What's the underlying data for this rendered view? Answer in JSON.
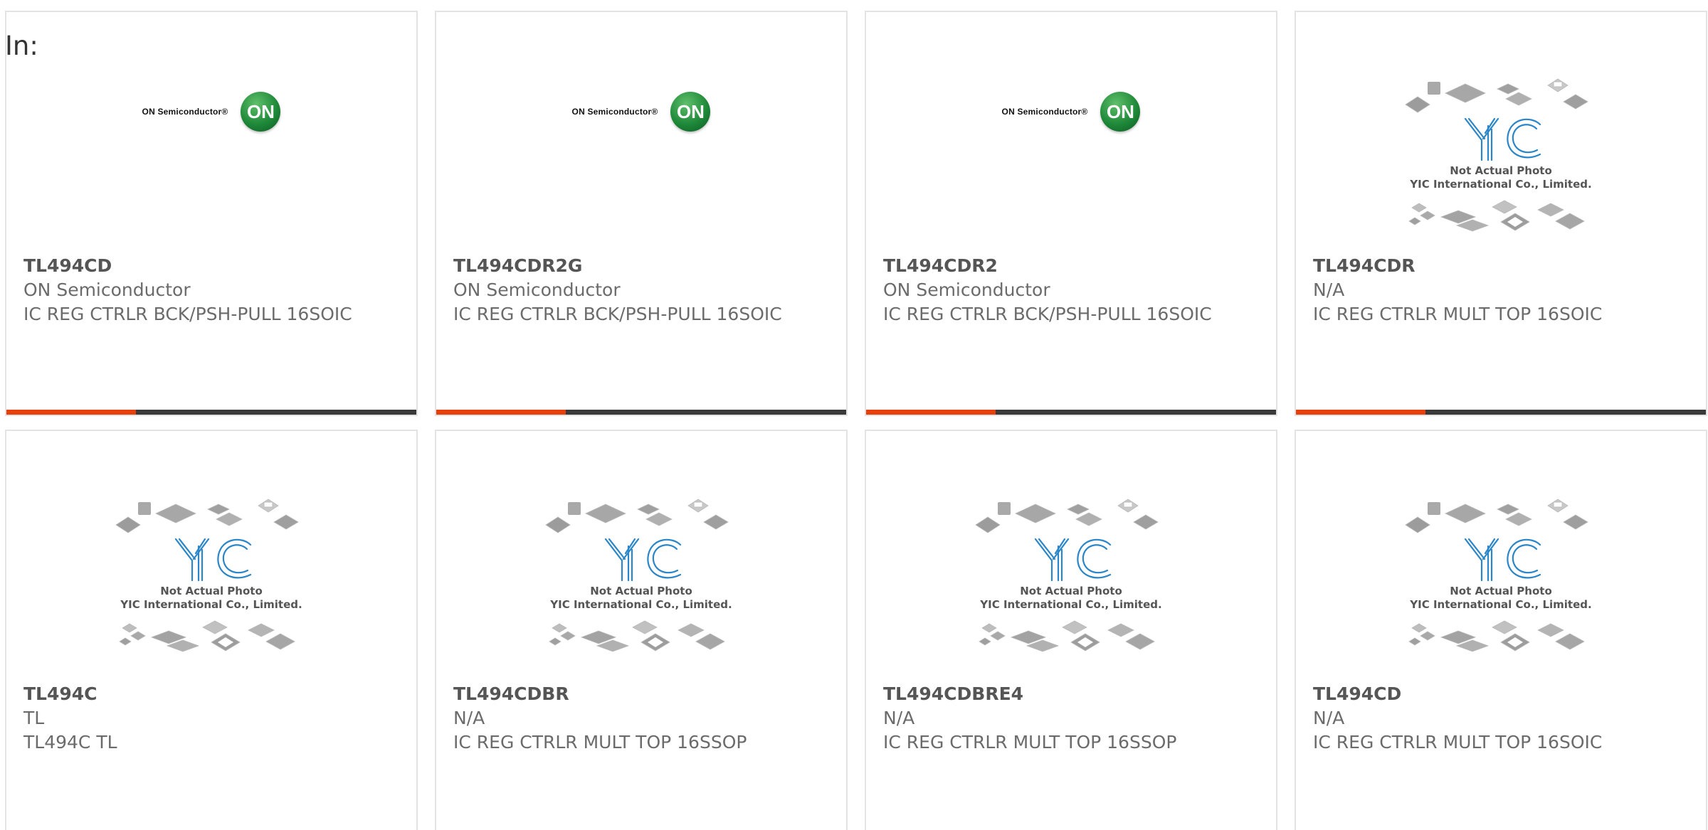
{
  "header": {
    "in_label": "In:"
  },
  "colors": {
    "accent": "#e8400c",
    "bar": "#3a3a3a",
    "border": "#e3e3e3",
    "text": "#6b6b6b"
  },
  "cards": [
    {
      "part": "TL494CD",
      "manufacturer": "ON Semiconductor",
      "description": "IC REG CTRLR BCK/PSH-PULL 16SOIC",
      "image": "on-semiconductor-logo",
      "logo_wordmark": "ON Semiconductor®",
      "logo_mark": "ON"
    },
    {
      "part": "TL494CDR2G",
      "manufacturer": "ON Semiconductor",
      "description": "IC REG CTRLR BCK/PSH-PULL 16SOIC",
      "image": "on-semiconductor-logo",
      "logo_wordmark": "ON Semiconductor®",
      "logo_mark": "ON"
    },
    {
      "part": "TL494CDR2",
      "manufacturer": "ON Semiconductor",
      "description": "IC REG CTRLR BCK/PSH-PULL 16SOIC",
      "image": "on-semiconductor-logo",
      "logo_wordmark": "ON Semiconductor®",
      "logo_mark": "ON"
    },
    {
      "part": "TL494CDR",
      "manufacturer": "N/A",
      "description": "IC REG CTRLR MULT TOP 16SOIC",
      "image": "yic-placeholder",
      "ph_line1": "Not Actual Photo",
      "ph_line2": "YIC International Co., Limited."
    },
    {
      "part": "TL494C",
      "manufacturer": "TL",
      "description": "TL494C TL",
      "image": "yic-placeholder",
      "ph_line1": "Not Actual Photo",
      "ph_line2": "YIC International Co., Limited."
    },
    {
      "part": "TL494CDBR",
      "manufacturer": "N/A",
      "description": "IC REG CTRLR MULT TOP 16SSOP",
      "image": "yic-placeholder",
      "ph_line1": "Not Actual Photo",
      "ph_line2": "YIC International Co., Limited."
    },
    {
      "part": "TL494CDBRE4",
      "manufacturer": "N/A",
      "description": "IC REG CTRLR MULT TOP 16SSOP",
      "image": "yic-placeholder",
      "ph_line1": "Not Actual Photo",
      "ph_line2": "YIC International Co., Limited."
    },
    {
      "part": "TL494CD",
      "manufacturer": "N/A",
      "description": "IC REG CTRLR MULT TOP 16SOIC",
      "image": "yic-placeholder",
      "ph_line1": "Not Actual Photo",
      "ph_line2": "YIC International Co., Limited."
    }
  ]
}
